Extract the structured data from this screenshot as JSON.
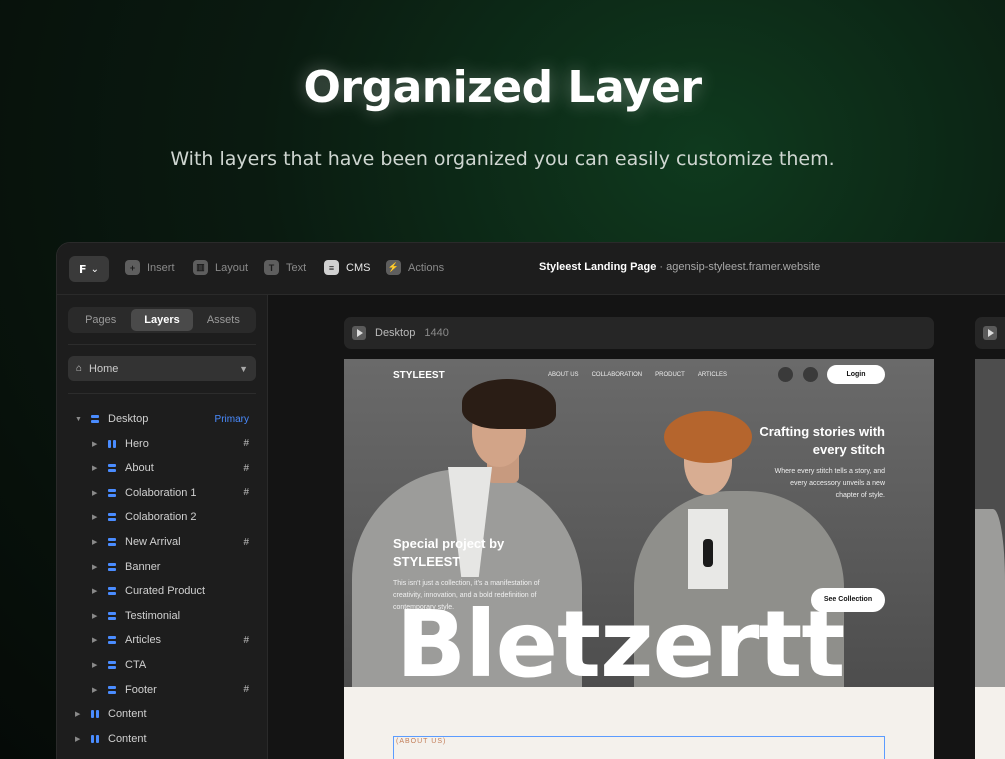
{
  "hero": {
    "title": "Organized Layer",
    "subtitle": "With layers that have been organized you can easily customize them."
  },
  "toolbar": {
    "logo_caret": "⌄",
    "tools": [
      {
        "label": "Insert",
        "icon": "plus-icon",
        "glyph": "+"
      },
      {
        "label": "Layout",
        "icon": "layout-icon",
        "glyph": "▥"
      },
      {
        "label": "Text",
        "icon": "text-icon",
        "glyph": "T"
      },
      {
        "label": "CMS",
        "icon": "database-icon",
        "glyph": "≡"
      },
      {
        "label": "Actions",
        "icon": "bolt-icon",
        "glyph": "⚡"
      }
    ],
    "doc_name": "Styleest Landing Page",
    "doc_sep": " · ",
    "doc_url": "agensip-styleest.framer.website"
  },
  "sidebar": {
    "tabs": [
      "Pages",
      "Layers",
      "Assets"
    ],
    "active_tab": "Layers",
    "page_select": "Home",
    "tree": [
      {
        "label": "Desktop",
        "level": 0,
        "icon": "stack",
        "badge": "Primary"
      },
      {
        "label": "Hero",
        "level": 1,
        "icon": "cols",
        "hash": "#"
      },
      {
        "label": "About",
        "level": 1,
        "icon": "stack",
        "hash": "#"
      },
      {
        "label": "Colaboration 1",
        "level": 1,
        "icon": "stack",
        "hash": "#"
      },
      {
        "label": "Colaboration 2",
        "level": 1,
        "icon": "stack",
        "hash": ""
      },
      {
        "label": "New Arrival",
        "level": 1,
        "icon": "stack",
        "hash": "#"
      },
      {
        "label": "Banner",
        "level": 1,
        "icon": "stack",
        "hash": ""
      },
      {
        "label": "Curated Product",
        "level": 1,
        "icon": "stack",
        "hash": ""
      },
      {
        "label": "Testimonial",
        "level": 1,
        "icon": "stack",
        "hash": ""
      },
      {
        "label": "Articles",
        "level": 1,
        "icon": "stack",
        "hash": "#"
      },
      {
        "label": "CTA",
        "level": 1,
        "icon": "stack",
        "hash": ""
      },
      {
        "label": "Footer",
        "level": 1,
        "icon": "stack",
        "hash": "#"
      },
      {
        "label": "Content",
        "level": 0,
        "icon": "cols",
        "hash": ""
      },
      {
        "label": "Content",
        "level": 0,
        "icon": "cols",
        "hash": ""
      }
    ]
  },
  "canvas": {
    "frame_name": "Desktop",
    "frame_width": "1440"
  },
  "site": {
    "logo": "STYLEEST",
    "nav": [
      "ABOUT US",
      "COLLABORATION",
      "PRODUCT",
      "ARTICLES"
    ],
    "login": "Login",
    "craft_title": "Crafting stories with every stitch",
    "craft_desc": "Where every stitch tells a story, and every accessory unveils a new chapter of style.",
    "special_title": "Special project by STYLEEST",
    "special_desc": "This isn't just a collection, it's a manifestation of creativity, innovation, and a bold redefinition of contemporary style.",
    "see_collection": "See Collection",
    "big_word": "Bletzertt",
    "about_label": "(ABOUT US)"
  },
  "colors": {
    "accent_blue": "#4a8cff",
    "background_green": "#0f3a1e",
    "selection_outline": "#5b9cff"
  }
}
